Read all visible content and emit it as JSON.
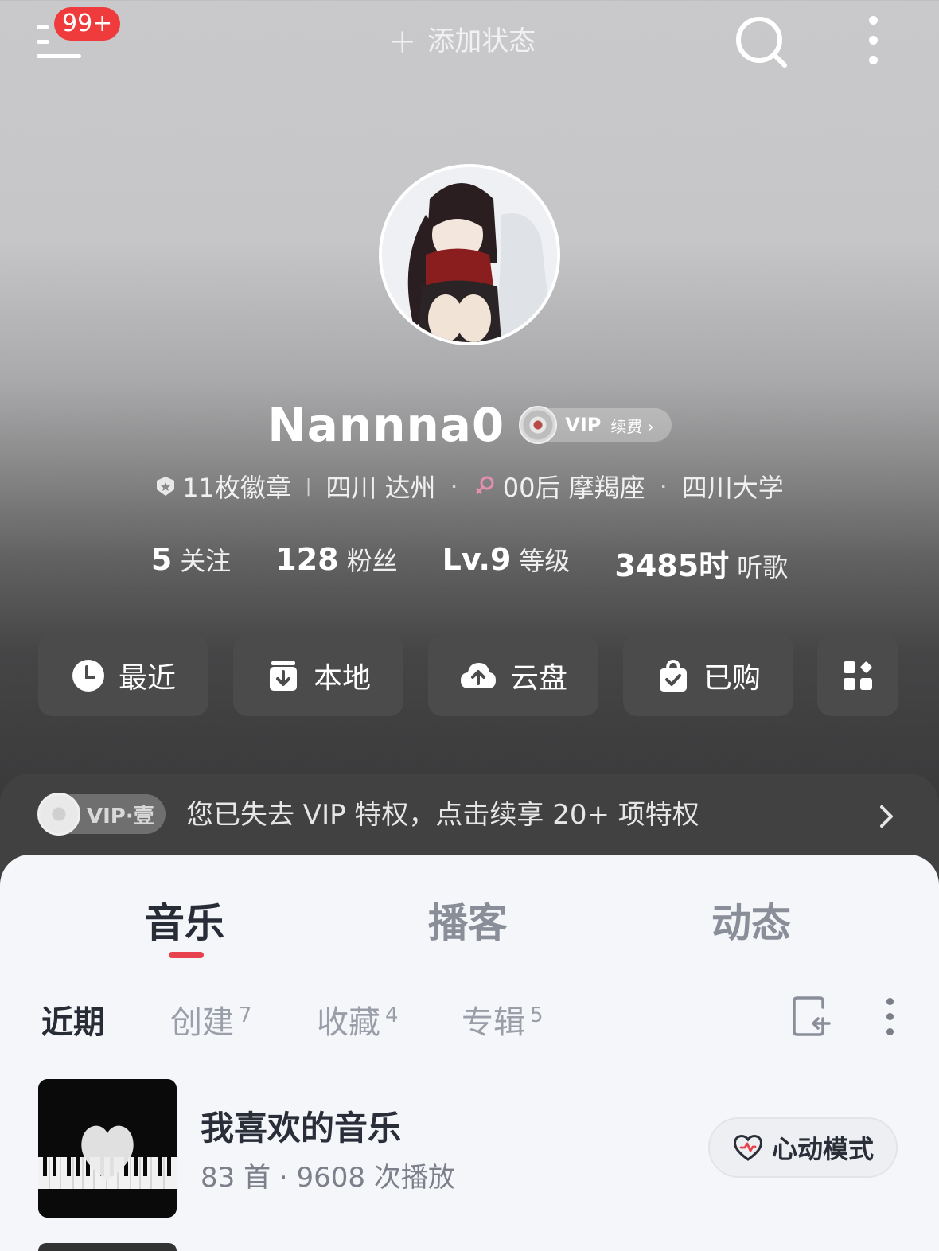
{
  "topbar": {
    "notification_badge": "99+",
    "add_status_icon": "+",
    "add_status_label": "添加状态",
    "search_icon": "search-icon",
    "more_icon": "more-vertical-icon"
  },
  "profile": {
    "username": "Nannna0",
    "vip_label": "VIP",
    "vip_renew": "续费 ›",
    "badges": "11枚徽章",
    "location": "四川 达州",
    "birth": "00后 摩羯座",
    "school": "四川大学",
    "separator_dot": "·",
    "separator_bar": "|"
  },
  "stats": [
    {
      "num": "5",
      "label": "关注"
    },
    {
      "num": "128",
      "label": "粉丝"
    },
    {
      "num": "Lv.9",
      "label": "等级"
    },
    {
      "num": "3485时",
      "label": "听歌"
    }
  ],
  "quick_buttons": [
    {
      "label": "最近",
      "icon": "clock-icon"
    },
    {
      "label": "本地",
      "icon": "download-icon"
    },
    {
      "label": "云盘",
      "icon": "cloud-upload-icon"
    },
    {
      "label": "已购",
      "icon": "bag-check-icon"
    },
    {
      "label": "",
      "icon": "grid-apps-icon"
    }
  ],
  "vip_banner": {
    "pill": "VIP·壹",
    "text": "您已失去 VIP 特权，点击续享 20+ 项特权"
  },
  "tabs": [
    "音乐",
    "播客",
    "动态"
  ],
  "subtabs": [
    {
      "label": "近期",
      "count": ""
    },
    {
      "label": "创建",
      "count": "7"
    },
    {
      "label": "收藏",
      "count": "4"
    },
    {
      "label": "专辑",
      "count": "5"
    }
  ],
  "playlist": {
    "title": "我喜欢的音乐",
    "meta": "83 首 · 9608 次播放",
    "heart_mode": "心动模式"
  },
  "colors": {
    "accent": "#e8424e",
    "badge": "#ef3b3b",
    "panel_bg": "#f5f6fa"
  }
}
